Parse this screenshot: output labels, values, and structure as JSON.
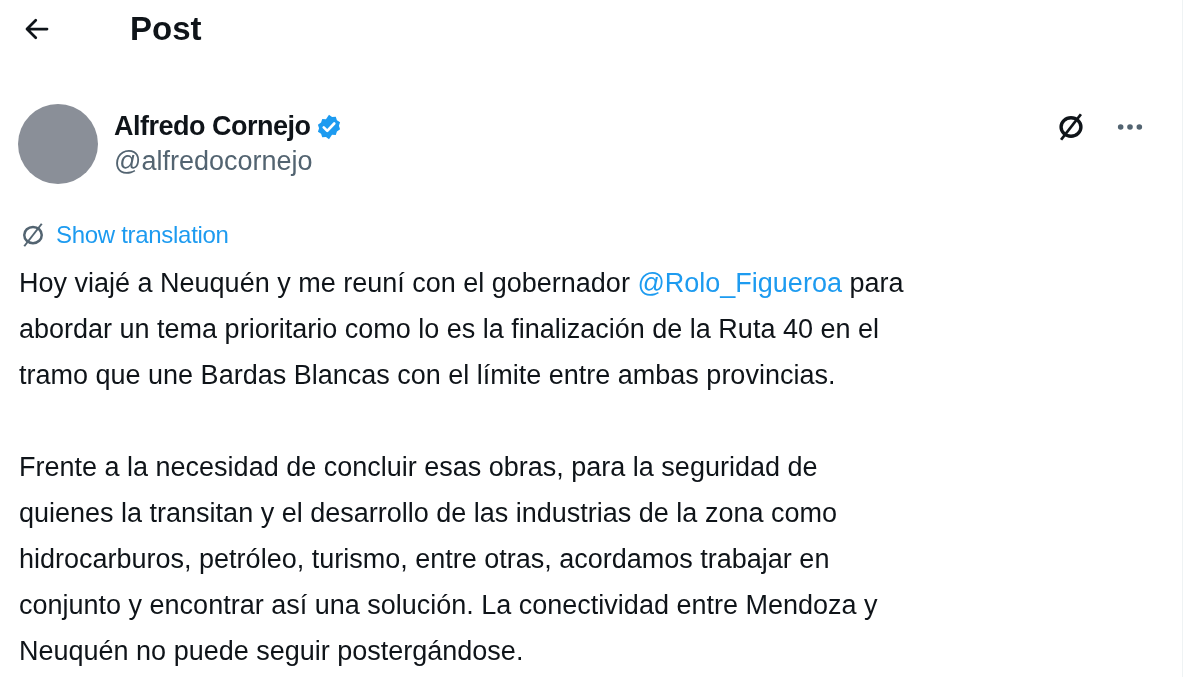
{
  "header": {
    "title": "Post"
  },
  "post": {
    "author": {
      "name": "Alfredo Cornejo",
      "verified": true,
      "handle": "@alfredocornejo"
    },
    "translate_link": "Show translation",
    "paragraphs": [
      {
        "lines": [
          [
            {
              "kind": "text",
              "text": "Hoy viajé a Neuquén y me reuní con el gobernador "
            },
            {
              "kind": "mention",
              "text": "@Rolo_Figueroa"
            },
            {
              "kind": "text",
              "text": " para"
            }
          ],
          [
            {
              "kind": "text",
              "text": "abordar un tema prioritario como lo es la finalización de la Ruta 40 en el"
            }
          ],
          [
            {
              "kind": "text",
              "text": "tramo que une Bardas Blancas con el límite entre ambas provincias."
            }
          ]
        ]
      },
      {
        "lines": [
          [
            {
              "kind": "text",
              "text": "Frente a la necesidad de concluir esas obras, para la seguridad de"
            }
          ],
          [
            {
              "kind": "text",
              "text": "quienes la transitan y el desarrollo de las industrias de la zona como"
            }
          ],
          [
            {
              "kind": "text",
              "text": "hidrocarburos, petróleo, turismo, entre otras, acordamos trabajar en"
            }
          ],
          [
            {
              "kind": "text",
              "text": "conjunto y encontrar así una solución. La conectividad entre Mendoza y"
            }
          ],
          [
            {
              "kind": "text",
              "text": "Neuquén no puede seguir postergándose."
            }
          ]
        ]
      }
    ]
  }
}
